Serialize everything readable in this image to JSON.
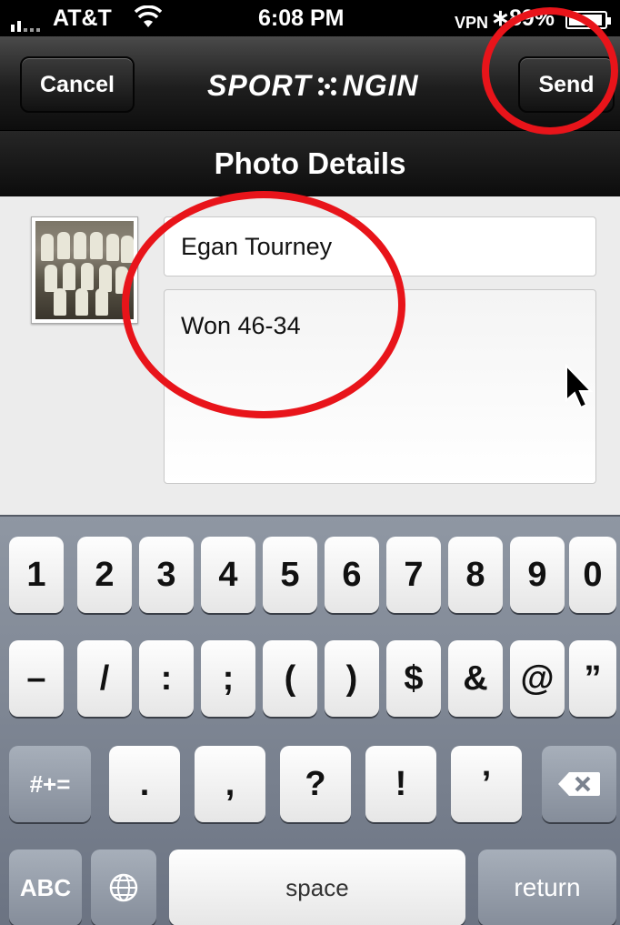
{
  "status_bar": {
    "carrier": "AT&T",
    "time": "6:08 PM",
    "battery": "89%",
    "vpn_label": "VPN",
    "bluetooth_symbol": "∗"
  },
  "nav": {
    "cancel_label": "Cancel",
    "logo_left": "SPORT",
    "logo_right": "NGIN",
    "send_label": "Send"
  },
  "title": "Photo Details",
  "form": {
    "title_value": "Egan Tourney",
    "description_value": "Won 46-34"
  },
  "keyboard": {
    "row1": [
      "1",
      "2",
      "3",
      "4",
      "5",
      "6",
      "7",
      "8",
      "9",
      "0"
    ],
    "row2": [
      "–",
      "/",
      ":",
      ";",
      "(",
      ")",
      "$",
      "&",
      "@",
      "”"
    ],
    "row3": {
      "toggle": "#+=",
      "keys": [
        ".",
        ",",
        "?",
        "!",
        "’"
      ],
      "delete": "⌫"
    },
    "row4": {
      "abc": "ABC",
      "globe": "🌐",
      "space": "space",
      "return": "return"
    }
  },
  "colors": {
    "annotation": "#e8141a",
    "nav_bg": "#1e1e1e",
    "content_bg": "#ececec"
  }
}
